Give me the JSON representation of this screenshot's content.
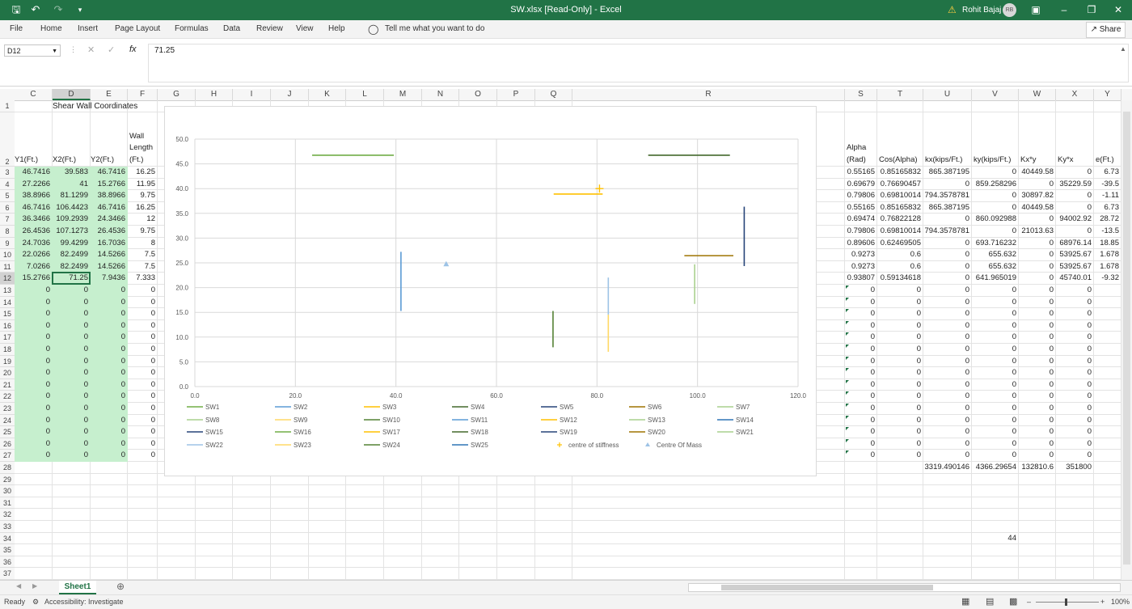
{
  "titlebar": {
    "doc_title": "SW.xlsx  [Read-Only]  -  Excel",
    "user_name": "Rohit Bajaj",
    "avatar_initials": "RB",
    "warning_icon": "warning-icon"
  },
  "ribbon": {
    "tabs": [
      "File",
      "Home",
      "Insert",
      "Page Layout",
      "Formulas",
      "Data",
      "Review",
      "View",
      "Help"
    ],
    "tell_me": "Tell me what you want to do",
    "share": "Share"
  },
  "formula_bar": {
    "name_box": "D12",
    "value": "71.25",
    "fx": "fx"
  },
  "columns": [
    "C",
    "D",
    "E",
    "F",
    "G",
    "H",
    "I",
    "J",
    "K",
    "L",
    "M",
    "N",
    "O",
    "P",
    "Q",
    "R",
    "S",
    "T",
    "U",
    "V",
    "W",
    "X",
    "Y"
  ],
  "rows": [
    "1",
    "2",
    "3",
    "4",
    "5",
    "6",
    "7",
    "8",
    "9",
    "10",
    "11",
    "12",
    "13",
    "14",
    "15",
    "16",
    "17",
    "18",
    "19",
    "20",
    "21",
    "22",
    "23",
    "24",
    "25",
    "26",
    "27",
    "28",
    "29",
    "30",
    "31",
    "32",
    "33",
    "34",
    "35",
    "36",
    "37"
  ],
  "left_title": "Shear Wall Coordinates",
  "left_headers": {
    "c": "Y1(Ft.)",
    "d": "X2(Ft.)",
    "e": "Y2(Ft.)",
    "f1": "Wall",
    "f2": "Length",
    "f3": "(Ft.)"
  },
  "left_data": [
    [
      "46.7416",
      "39.583",
      "46.7416",
      "16.25"
    ],
    [
      "27.2266",
      "41",
      "15.2766",
      "11.95"
    ],
    [
      "38.8966",
      "81.1299",
      "38.8966",
      "9.75"
    ],
    [
      "46.7416",
      "106.4423",
      "46.7416",
      "16.25"
    ],
    [
      "36.3466",
      "109.2939",
      "24.3466",
      "12"
    ],
    [
      "26.4536",
      "107.1273",
      "26.4536",
      "9.75"
    ],
    [
      "24.7036",
      "99.4299",
      "16.7036",
      "8"
    ],
    [
      "22.0266",
      "82.2499",
      "14.5266",
      "7.5"
    ],
    [
      "7.0266",
      "82.2499",
      "14.5266",
      "7.5"
    ],
    [
      "15.2766",
      "71.25",
      "7.9436",
      "7.333"
    ]
  ],
  "zero": "0",
  "right_headers": {
    "s1": "Alpha",
    "s2": "(Rad)",
    "t": "Cos(Alpha)",
    "u": "kx(kips/Ft.)",
    "v": "ky(kips/Ft.)",
    "w": "Kx*y",
    "x": "Ky*x",
    "y": "e(Ft.)"
  },
  "right_data": [
    [
      "0.55165",
      "0.85165832",
      "865.387195",
      "0",
      "40449.58",
      "0",
      "6.73"
    ],
    [
      "0.69679",
      "0.76690457",
      "0",
      "859.258296",
      "0",
      "35229.59",
      "-39.5"
    ],
    [
      "0.79806",
      "0.69810014",
      "794.3578781",
      "0",
      "30897.82",
      "0",
      "-1.11"
    ],
    [
      "0.55165",
      "0.85165832",
      "865.387195",
      "0",
      "40449.58",
      "0",
      "6.73"
    ],
    [
      "0.69474",
      "0.76822128",
      "0",
      "860.092988",
      "0",
      "94002.92",
      "28.72"
    ],
    [
      "0.79806",
      "0.69810014",
      "794.3578781",
      "0",
      "21013.63",
      "0",
      "-13.5"
    ],
    [
      "0.89606",
      "0.62469505",
      "0",
      "693.716232",
      "0",
      "68976.14",
      "18.85"
    ],
    [
      "0.9273",
      "0.6",
      "0",
      "655.632",
      "0",
      "53925.67",
      "1.678"
    ],
    [
      "0.9273",
      "0.6",
      "0",
      "655.632",
      "0",
      "53925.67",
      "1.678"
    ],
    [
      "0.93807",
      "0.59134618",
      "0",
      "641.965019",
      "0",
      "45740.01",
      "-9.32"
    ]
  ],
  "totals": {
    "u": "3319.490146",
    "v": "4366.29654",
    "w": "132810.6",
    "x": "351800"
  },
  "v34": "44",
  "chart_data": {
    "type": "scatter",
    "xlim": [
      0,
      120
    ],
    "ylim": [
      0,
      50
    ],
    "x_ticks": [
      "0.0",
      "20.0",
      "40.0",
      "60.0",
      "80.0",
      "100.0",
      "120.0"
    ],
    "y_ticks": [
      "0.0",
      "5.0",
      "10.0",
      "15.0",
      "20.0",
      "25.0",
      "30.0",
      "35.0",
      "40.0",
      "45.0",
      "50.0"
    ],
    "grid": true,
    "legend": "bottom",
    "segments": [
      {
        "name": "SW1",
        "color": "#70ad47",
        "x": [
          23.33,
          39.58
        ],
        "y": [
          46.74,
          46.74
        ]
      },
      {
        "name": "SW2",
        "color": "#5b9bd5",
        "x": [
          41,
          41
        ],
        "y": [
          27.23,
          15.28
        ]
      },
      {
        "name": "SW3",
        "color": "#ffc000",
        "x": [
          71.38,
          81.13
        ],
        "y": [
          38.9,
          38.9
        ]
      },
      {
        "name": "SW4",
        "color": "#43682b",
        "x": [
          90.19,
          106.44
        ],
        "y": [
          46.74,
          46.74
        ]
      },
      {
        "name": "SW5",
        "color": "#264478",
        "x": [
          109.29,
          109.29
        ],
        "y": [
          36.35,
          24.35
        ]
      },
      {
        "name": "SW6",
        "color": "#9e7300",
        "x": [
          97.38,
          107.13
        ],
        "y": [
          26.45,
          26.45
        ]
      },
      {
        "name": "SW7",
        "color": "#a9d18e",
        "x": [
          99.43,
          99.43
        ],
        "y": [
          24.7,
          16.7
        ]
      },
      {
        "name": "SW8",
        "color": "#9dc3e6",
        "x": [
          82.25,
          82.25
        ],
        "y": [
          22.03,
          14.53
        ]
      },
      {
        "name": "SW9",
        "color": "#ffd966",
        "x": [
          82.25,
          82.25
        ],
        "y": [
          7.03,
          14.53
        ]
      },
      {
        "name": "SW10",
        "color": "#548235",
        "x": [
          71.25,
          71.25
        ],
        "y": [
          15.28,
          7.94
        ]
      }
    ],
    "centre_of_stiffness": {
      "x": 80.5,
      "y": 40.0,
      "color": "#ffc000"
    },
    "centre_of_mass": {
      "x": 50.0,
      "y": 24.8,
      "color": "#9dc3e6"
    },
    "legend_entries": [
      {
        "name": "SW1",
        "color": "#70ad47"
      },
      {
        "name": "SW2",
        "color": "#5b9bd5"
      },
      {
        "name": "SW3",
        "color": "#ffc000"
      },
      {
        "name": "SW4",
        "color": "#43682b"
      },
      {
        "name": "SW5",
        "color": "#264478"
      },
      {
        "name": "SW6",
        "color": "#9e7300"
      },
      {
        "name": "SW7",
        "color": "#a9d18e"
      },
      {
        "name": "SW8",
        "color": "#a9d18e"
      },
      {
        "name": "SW9",
        "color": "#ffd966"
      },
      {
        "name": "SW10",
        "color": "#548235"
      },
      {
        "name": "SW11",
        "color": "#5b9bd5"
      },
      {
        "name": "SW12",
        "color": "#ffc000"
      },
      {
        "name": "SW13",
        "color": "#a9d18e"
      },
      {
        "name": "SW14",
        "color": "#2e75b6"
      },
      {
        "name": "SW15",
        "color": "#264478"
      },
      {
        "name": "SW16",
        "color": "#70ad47"
      },
      {
        "name": "SW17",
        "color": "#ffc000"
      },
      {
        "name": "SW18",
        "color": "#43682b"
      },
      {
        "name": "SW19",
        "color": "#264478"
      },
      {
        "name": "SW20",
        "color": "#9e7300"
      },
      {
        "name": "SW21",
        "color": "#a9d18e"
      },
      {
        "name": "SW22",
        "color": "#9dc3e6"
      },
      {
        "name": "SW23",
        "color": "#ffd966"
      },
      {
        "name": "SW24",
        "color": "#548235"
      },
      {
        "name": "SW25",
        "color": "#2e75b6"
      },
      {
        "name": "centre of stiffness",
        "color": "#ffc000",
        "marker": "+"
      },
      {
        "name": "Centre Of Mass",
        "color": "#9dc3e6",
        "marker": "tri"
      }
    ]
  },
  "sheet_tab": "Sheet1",
  "status": {
    "ready": "Ready",
    "accessibility": "Accessibility: Investigate",
    "zoom": "100%"
  },
  "colors": {
    "excel_green": "#217346",
    "cell_green": "#c6efce"
  }
}
